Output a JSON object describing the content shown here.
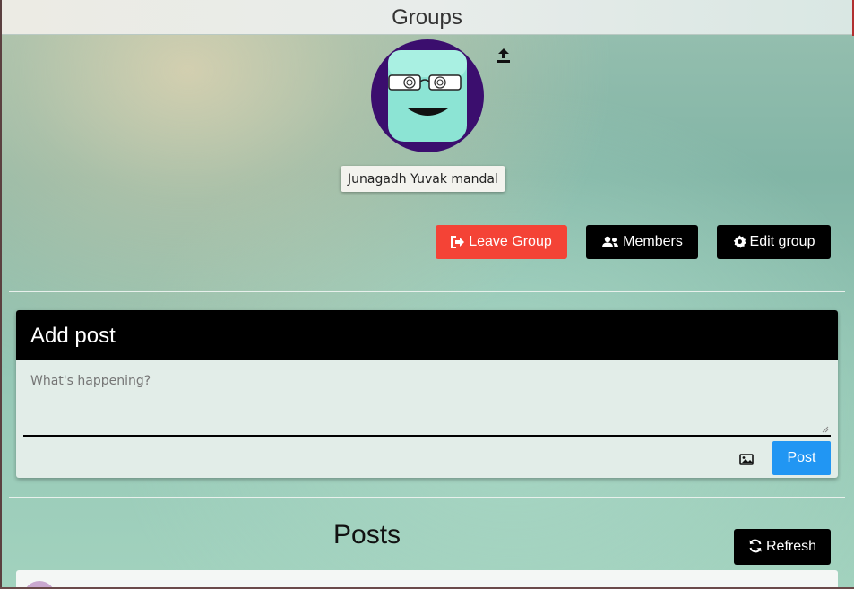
{
  "header": {
    "title": "Groups"
  },
  "group": {
    "name": "Junagadh Yuvak mandal"
  },
  "actions": {
    "leave_label": "Leave Group",
    "members_label": "Members",
    "edit_label": "Edit group"
  },
  "add_post": {
    "title": "Add post",
    "placeholder": "What's happening?",
    "post_label": "Post"
  },
  "posts": {
    "title": "Posts",
    "refresh_label": "Refresh"
  },
  "colors": {
    "leave": "#f44336",
    "post": "#2196f3",
    "dark_button": "#000000",
    "avatar_ring": "#3b0e6e",
    "avatar_face": "#8ce4d4"
  },
  "icons": {
    "upload": "upload-icon",
    "leave": "sign-out-icon",
    "members": "users-icon",
    "edit": "gear-icon",
    "image": "image-icon",
    "refresh": "refresh-icon"
  }
}
